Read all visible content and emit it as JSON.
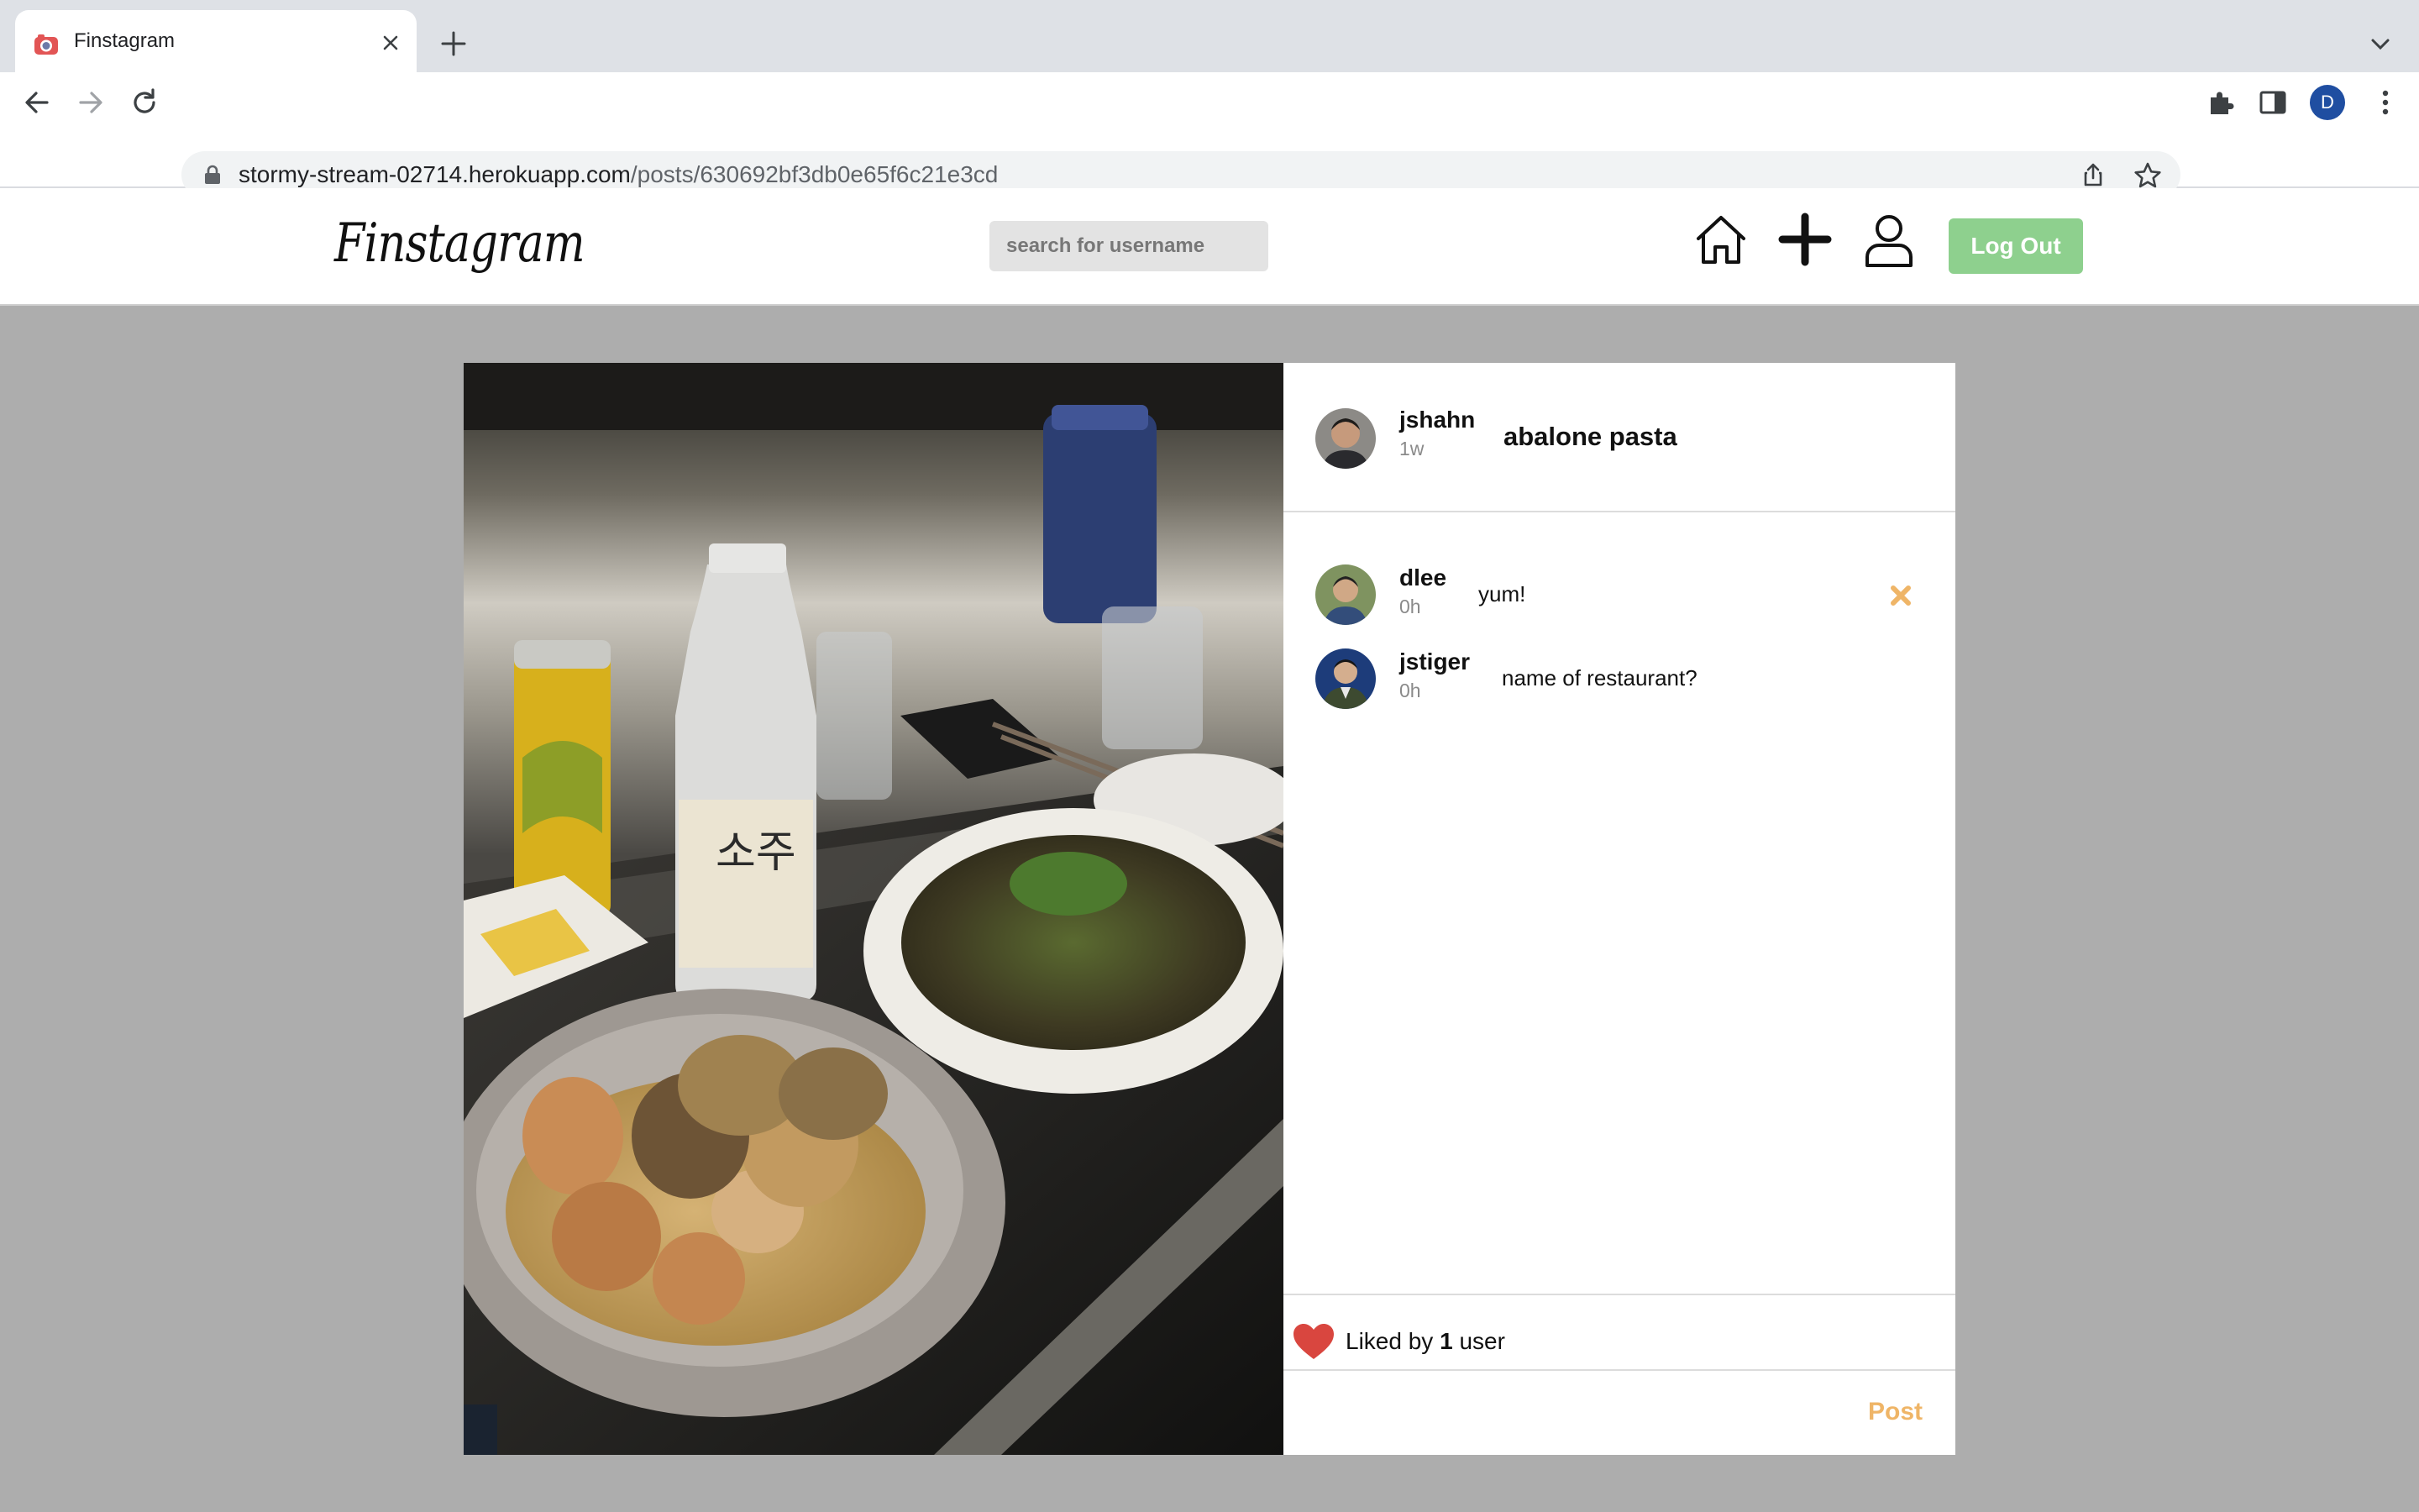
{
  "browser": {
    "tab_title": "Finstagram",
    "url_host": "stormy-stream-02714.herokuapp.com",
    "url_path": "/posts/630692bf3db0e65f6c21e3cd",
    "profile_initial": "D"
  },
  "header": {
    "logo": "Finstagram",
    "search_placeholder": "search for username",
    "logout_label": "Log Out"
  },
  "post": {
    "author": "jshahn",
    "time": "1w",
    "caption": "abalone pasta",
    "comments": [
      {
        "user": "dlee",
        "time": "0h",
        "text": "yum!",
        "deletable": true
      },
      {
        "user": "jstiger",
        "time": "0h",
        "text": "name of restaurant?",
        "deletable": false
      }
    ],
    "likes_prefix": "Liked by",
    "likes_count": "1",
    "likes_suffix": "user",
    "post_label": "Post"
  },
  "colors": {
    "accent_orange": "#efb567",
    "logout_green": "#8ed08e",
    "heart_red": "#d9463f",
    "page_bg": "#adadad"
  }
}
